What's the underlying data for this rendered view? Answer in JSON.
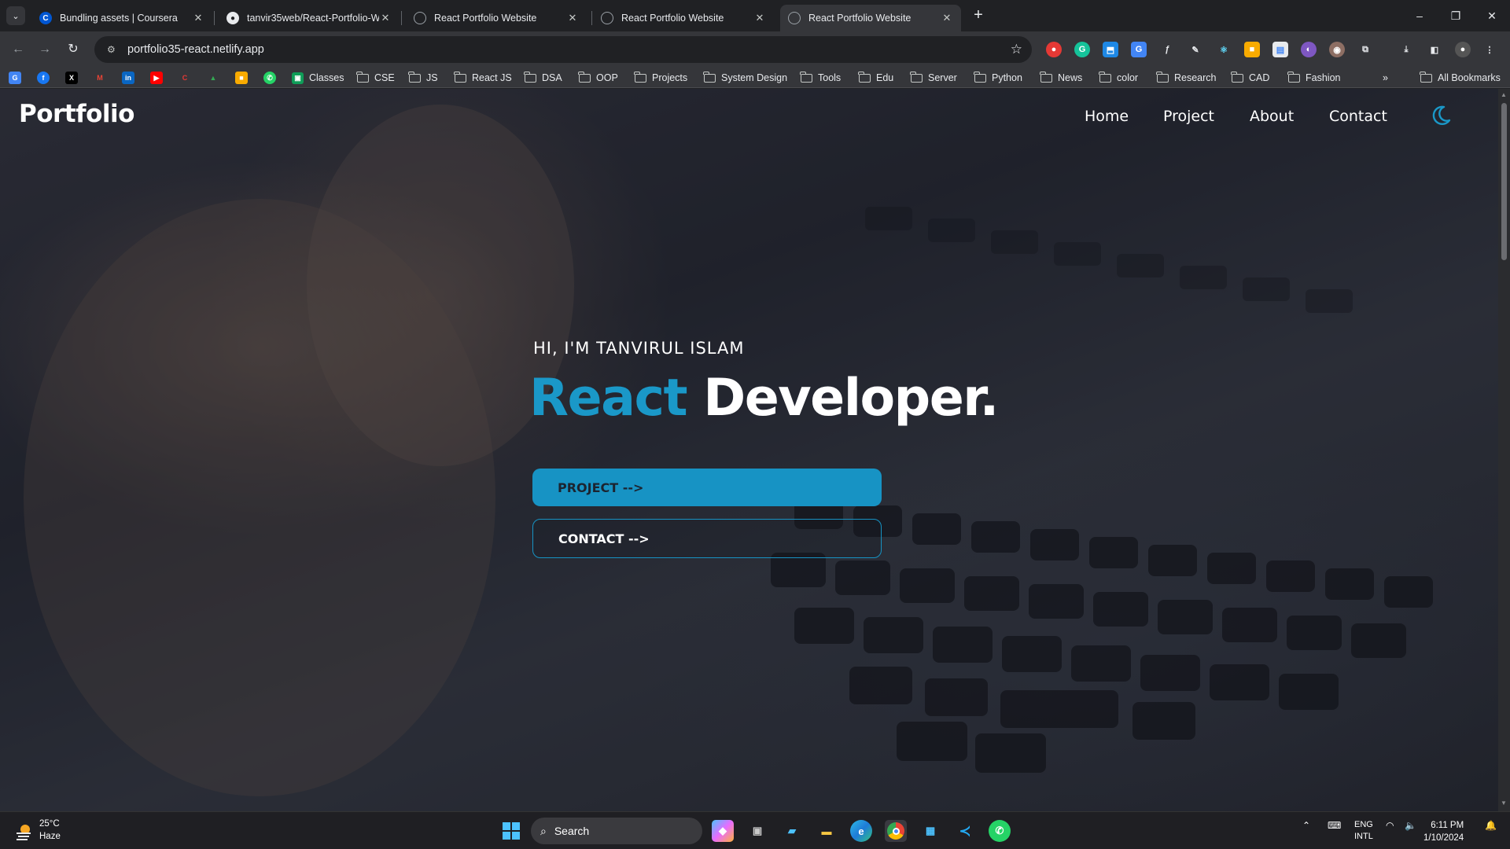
{
  "browser": {
    "tabs": [
      {
        "title": "Bundling assets | Coursera",
        "icon": "coursera-icon",
        "active": false
      },
      {
        "title": "tanvir35web/React-Portfolio-W",
        "icon": "github-icon",
        "active": false
      },
      {
        "title": "React Portfolio Website",
        "icon": "globe-icon",
        "active": false
      },
      {
        "title": "React Portfolio Website",
        "icon": "globe-icon",
        "active": false
      },
      {
        "title": "React Portfolio Website",
        "icon": "globe-icon",
        "active": true
      }
    ],
    "url": "portfolio35-react.netlify.app",
    "bookmarks": [
      "Classes",
      "CSE",
      "JS",
      "React JS",
      "DSA",
      "OOP",
      "Projects",
      "System Design",
      "Tools",
      "Edu",
      "Server",
      "Python",
      "News",
      "color",
      "Research",
      "CAD",
      "Fashion"
    ],
    "all_bookmarks_label": "All Bookmarks"
  },
  "site": {
    "logo": "Portfolio",
    "nav": [
      "Home",
      "Project",
      "About",
      "Contact"
    ],
    "hero": {
      "greeting": "HI, I'M TANVIRUL ISLAM",
      "headline_accent": "React",
      "headline_rest": "Developer.",
      "accent_color": "#1a98c8",
      "primary_button": "PROJECT -->",
      "secondary_button": "CONTACT -->"
    }
  },
  "taskbar": {
    "weather_temp": "25°C",
    "weather_condition": "Haze",
    "search_label": "Search",
    "language": "ENG",
    "layout": "INTL",
    "time": "6:11 PM",
    "date": "1/10/2024"
  }
}
